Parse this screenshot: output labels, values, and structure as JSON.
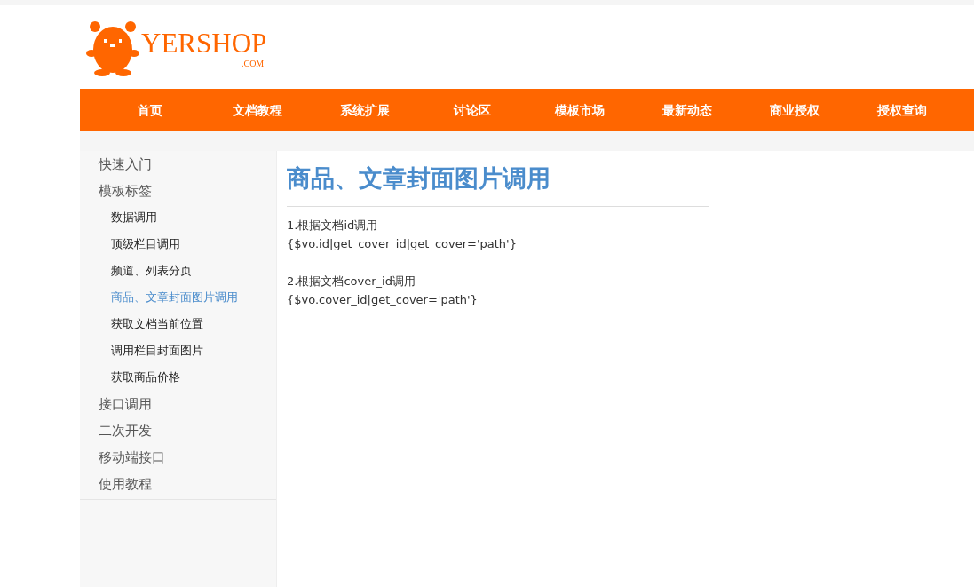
{
  "logo": {
    "name": "YERSHOP",
    "suffix": ".COM"
  },
  "nav": [
    {
      "label": "首页"
    },
    {
      "label": "文档教程"
    },
    {
      "label": "系统扩展"
    },
    {
      "label": "讨论区"
    },
    {
      "label": "模板市场"
    },
    {
      "label": "最新动态"
    },
    {
      "label": "商业授权"
    },
    {
      "label": "授权查询"
    }
  ],
  "sidebar": {
    "items": [
      {
        "label": "快速入门",
        "selected": false
      },
      {
        "label": "模板标签",
        "selected": false,
        "children": [
          {
            "label": "数据调用",
            "selected": false
          },
          {
            "label": "顶级栏目调用",
            "selected": false
          },
          {
            "label": "频道、列表分页",
            "selected": false
          },
          {
            "label": "商品、文章封面图片调用",
            "selected": true
          },
          {
            "label": "获取文档当前位置",
            "selected": false
          },
          {
            "label": "调用栏目封面图片",
            "selected": false
          },
          {
            "label": "获取商品价格",
            "selected": false
          }
        ]
      },
      {
        "label": "接口调用",
        "selected": false
      },
      {
        "label": "二次开发",
        "selected": false
      },
      {
        "label": "移动端接口",
        "selected": false
      },
      {
        "label": "使用教程",
        "selected": false
      }
    ]
  },
  "article": {
    "title": "商品、文章封面图片调用",
    "blocks": [
      {
        "lines": [
          "1.根据文档id调用",
          "{$vo.id|get_cover_id|get_cover='path'}"
        ]
      },
      {
        "lines": [
          "2.根据文档cover_id调用",
          "{$vo.cover_id|get_cover='path'}"
        ]
      }
    ]
  }
}
